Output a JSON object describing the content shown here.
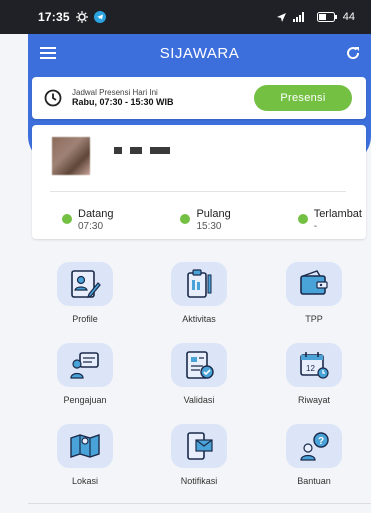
{
  "status_bar": {
    "time": "17:35",
    "battery": "44"
  },
  "app": {
    "title": "SIJAWARA"
  },
  "presensi": {
    "label": "Jadwal Presensi Hari Ini",
    "schedule": "Rabu, 07:30 - 15:30 WIB",
    "button_label": "Presensi"
  },
  "attendance": {
    "datang": {
      "label": "Datang",
      "value": "07:30"
    },
    "pulang": {
      "label": "Pulang",
      "value": "15:30"
    },
    "terlambat": {
      "label": "Terlambat",
      "value": "-"
    }
  },
  "menu": [
    {
      "label": "Profile",
      "icon": "profile-icon"
    },
    {
      "label": "Aktivitas",
      "icon": "clipboard-icon"
    },
    {
      "label": "TPP",
      "icon": "wallet-icon"
    },
    {
      "label": "Pengajuan",
      "icon": "submission-icon"
    },
    {
      "label": "Validasi",
      "icon": "validation-icon"
    },
    {
      "label": "Riwayat",
      "icon": "calendar-icon"
    },
    {
      "label": "Lokasi",
      "icon": "map-icon"
    },
    {
      "label": "Notifikasi",
      "icon": "notification-icon"
    },
    {
      "label": "Bantuan",
      "icon": "help-icon"
    }
  ],
  "colors": {
    "primary": "#3d6fdc",
    "accent_green": "#74c043",
    "icon_bg": "#dbe5f7"
  }
}
